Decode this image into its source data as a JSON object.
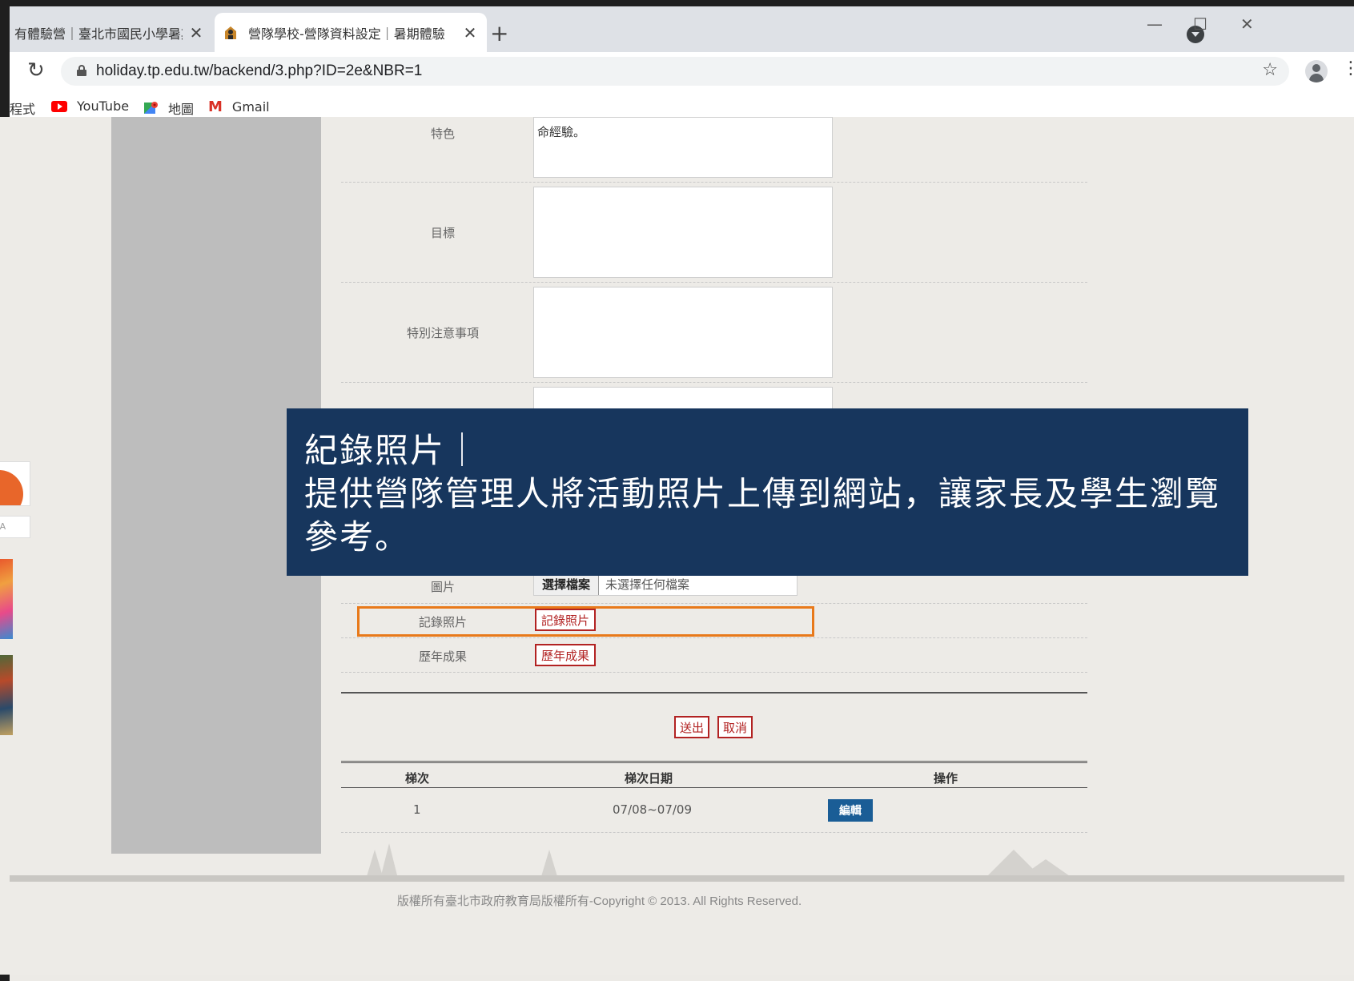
{
  "browser": {
    "tabs": [
      {
        "title": "有體驗營｜臺北市國民小學暑期",
        "close": "✕"
      },
      {
        "title": "營隊學校-營隊資料設定｜暑期體驗",
        "close": "✕"
      }
    ],
    "new_tab": "+",
    "url": "holiday.tp.edu.tw/backend/3.php?ID=2e&NBR=1",
    "bookmarks": [
      {
        "label": "程式",
        "icon": "apps-icon"
      },
      {
        "label": "YouTube",
        "icon": "youtube-icon"
      },
      {
        "label": "地圖",
        "icon": "maps-icon"
      },
      {
        "label": "Gmail",
        "icon": "gmail-icon"
      }
    ]
  },
  "side_strip": {
    "qa_label": "&A"
  },
  "form": {
    "feature_label": "特色",
    "feature_value": "命經驗。",
    "goal_label": "目標",
    "notes_label": "特別注意事項",
    "image_label": "圖片",
    "file_button": "選擇檔案",
    "file_status": "未選擇任何檔案",
    "photos_label": "記錄照片",
    "photos_button": "記錄照片",
    "results_label": "歷年成果",
    "results_button": "歷年成果",
    "submit": "送出",
    "cancel": "取消"
  },
  "table": {
    "headers": [
      "梯次",
      "梯次日期",
      "操作"
    ],
    "rows": [
      {
        "session": "1",
        "dates": "07/08~07/09",
        "action": "編輯"
      }
    ]
  },
  "footer": {
    "copyright": "版權所有臺北市政府教育局版權所有-Copyright © 2013. All Rights Reserved."
  },
  "callout": {
    "title": "紀錄照片｜",
    "body": "提供營隊管理人將活動照片上傳到網站，讓家長及學生瀏覽參考。"
  },
  "colors": {
    "callout_bg": "#17365d",
    "highlight": "#e8791a",
    "red_button": "#b22222",
    "edit_button": "#1a5d96"
  }
}
